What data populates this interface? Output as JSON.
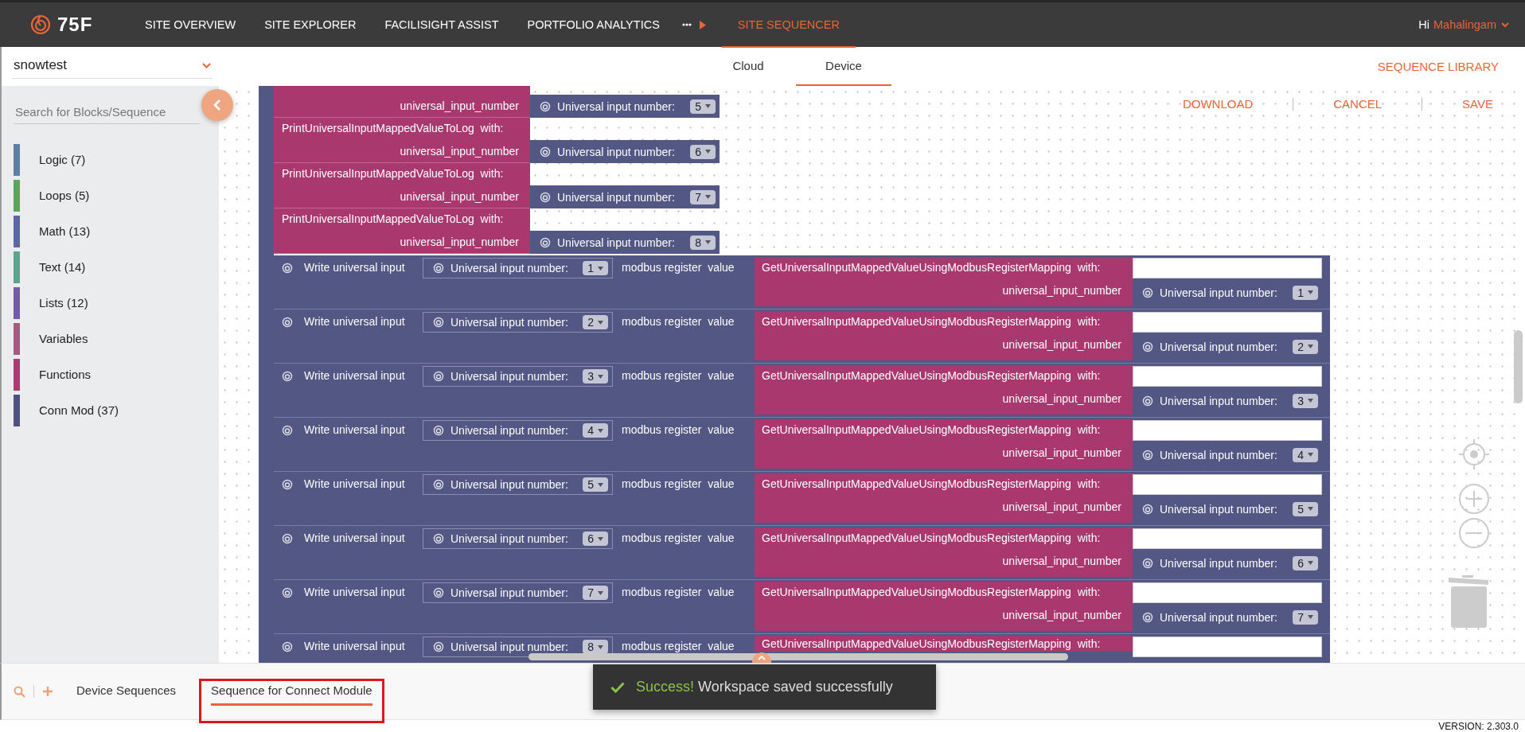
{
  "header": {
    "logo": "75F",
    "nav": [
      {
        "label": "SITE OVERVIEW",
        "selected": false
      },
      {
        "label": "SITE EXPLORER",
        "selected": false
      },
      {
        "label": "FACILISIGHT ASSIST",
        "selected": false
      },
      {
        "label": "PORTFOLIO ANALYTICS",
        "selected": false
      },
      {
        "label": "SITE SEQUENCER",
        "selected": true
      }
    ],
    "greeting": "Hi",
    "user": "Mahalingam"
  },
  "site_select": {
    "value": "snowtest"
  },
  "view_tabs": [
    {
      "label": "Cloud",
      "selected": false
    },
    {
      "label": "Device",
      "selected": true
    }
  ],
  "sequence_library": "SEQUENCE LIBRARY",
  "sidebar": {
    "search": {
      "placeholder": "Search for Blocks/Sequence"
    },
    "categories": [
      {
        "label": "Logic (7)",
        "color": "#5b80a5"
      },
      {
        "label": "Loops (5)",
        "color": "#5ba55b"
      },
      {
        "label": "Math (13)",
        "color": "#5b67a5"
      },
      {
        "label": "Text (14)",
        "color": "#5ba58c"
      },
      {
        "label": "Lists (12)",
        "color": "#745ba5"
      },
      {
        "label": "Variables",
        "color": "#a55b80"
      },
      {
        "label": "Functions",
        "color": "#ad3a70"
      },
      {
        "label": "Conn Mod (37)",
        "color": "#4f5281"
      }
    ]
  },
  "actions": [
    "DOWNLOAD",
    "CANCEL",
    "SAVE"
  ],
  "print_blocks": [
    {
      "param": "universal_input_number",
      "input_label": "Universal input number:",
      "value": "5"
    },
    {
      "title": "PrintUniversalInputMappedValueToLog",
      "with": "with:",
      "param": "universal_input_number",
      "input_label": "Universal input number:",
      "value": "6"
    },
    {
      "title": "PrintUniversalInputMappedValueToLog",
      "with": "with:",
      "param": "universal_input_number",
      "input_label": "Universal input number:",
      "value": "7"
    },
    {
      "title": "PrintUniversalInputMappedValueToLog",
      "with": "with:",
      "param": "universal_input_number",
      "input_label": "Universal input number:",
      "value": "8"
    }
  ],
  "write_blocks": [
    {
      "label": "Write universal input",
      "input_label": "Universal input number:",
      "value": "1",
      "register": "modbus register",
      "value_label": "value",
      "function": "GetUniversalInputMappedValueUsingModbusRegisterMapping",
      "with": "with:",
      "param": "universal_input_number",
      "param_input_label": "Universal input number:",
      "param_value": "1"
    },
    {
      "label": "Write universal input",
      "input_label": "Universal input number:",
      "value": "2",
      "register": "modbus register",
      "value_label": "value",
      "function": "GetUniversalInputMappedValueUsingModbusRegisterMapping",
      "with": "with:",
      "param": "universal_input_number",
      "param_input_label": "Universal input number:",
      "param_value": "2"
    },
    {
      "label": "Write universal input",
      "input_label": "Universal input number:",
      "value": "3",
      "register": "modbus register",
      "value_label": "value",
      "function": "GetUniversalInputMappedValueUsingModbusRegisterMapping",
      "with": "with:",
      "param": "universal_input_number",
      "param_input_label": "Universal input number:",
      "param_value": "3"
    },
    {
      "label": "Write universal input",
      "input_label": "Universal input number:",
      "value": "4",
      "register": "modbus register",
      "value_label": "value",
      "function": "GetUniversalInputMappedValueUsingModbusRegisterMapping",
      "with": "with:",
      "param": "universal_input_number",
      "param_input_label": "Universal input number:",
      "param_value": "4"
    },
    {
      "label": "Write universal input",
      "input_label": "Universal input number:",
      "value": "5",
      "register": "modbus register",
      "value_label": "value",
      "function": "GetUniversalInputMappedValueUsingModbusRegisterMapping",
      "with": "with:",
      "param": "universal_input_number",
      "param_input_label": "Universal input number:",
      "param_value": "5"
    },
    {
      "label": "Write universal input",
      "input_label": "Universal input number:",
      "value": "6",
      "register": "modbus register",
      "value_label": "value",
      "function": "GetUniversalInputMappedValueUsingModbusRegisterMapping",
      "with": "with:",
      "param": "universal_input_number",
      "param_input_label": "Universal input number:",
      "param_value": "6"
    },
    {
      "label": "Write universal input",
      "input_label": "Universal input number:",
      "value": "7",
      "register": "modbus register",
      "value_label": "value",
      "function": "GetUniversalInputMappedValueUsingModbusRegisterMapping",
      "with": "with:",
      "param": "universal_input_number",
      "param_input_label": "Universal input number:",
      "param_value": "7"
    },
    {
      "label": "Write universal input",
      "input_label": "Universal input number:",
      "value": "8",
      "register": "modbus register",
      "value_label": "value",
      "function": "GetUniversalInputMappedValueUsingModbusRegisterMapping",
      "with": "with:"
    }
  ],
  "bottom_tabs": [
    {
      "label": "Device Sequences",
      "selected": false,
      "highlighted": false
    },
    {
      "label": "Sequence for Connect Module",
      "selected": true,
      "highlighted": true
    }
  ],
  "toast": {
    "title": "Success!",
    "message": "Workspace saved successfully"
  },
  "version": "VERSION: 2.303.0"
}
